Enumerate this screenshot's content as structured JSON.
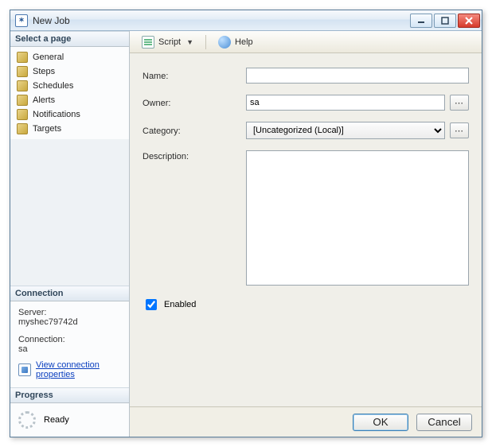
{
  "window": {
    "title": "New Job"
  },
  "winbtns": {
    "min": "minimize",
    "max": "maximize",
    "close": "close"
  },
  "left": {
    "pages_header": "Select a page",
    "pages": [
      {
        "label": "General"
      },
      {
        "label": "Steps"
      },
      {
        "label": "Schedules"
      },
      {
        "label": "Alerts"
      },
      {
        "label": "Notifications"
      },
      {
        "label": "Targets"
      }
    ],
    "connection_header": "Connection",
    "connection": {
      "server_label": "Server:",
      "server_value": "myshec79742d",
      "conn_label": "Connection:",
      "conn_value": "sa",
      "link": "View connection properties"
    },
    "progress_header": "Progress",
    "progress_status": "Ready"
  },
  "toolbar": {
    "script_label": "Script",
    "help_label": "Help"
  },
  "form": {
    "name_label": "Name:",
    "name_value": "",
    "owner_label": "Owner:",
    "owner_value": "sa",
    "category_label": "Category:",
    "category_value": "[Uncategorized (Local)]",
    "description_label": "Description:",
    "description_value": "",
    "enabled_label": "Enabled",
    "enabled_checked": true
  },
  "buttons": {
    "ok": "OK",
    "cancel": "Cancel"
  }
}
